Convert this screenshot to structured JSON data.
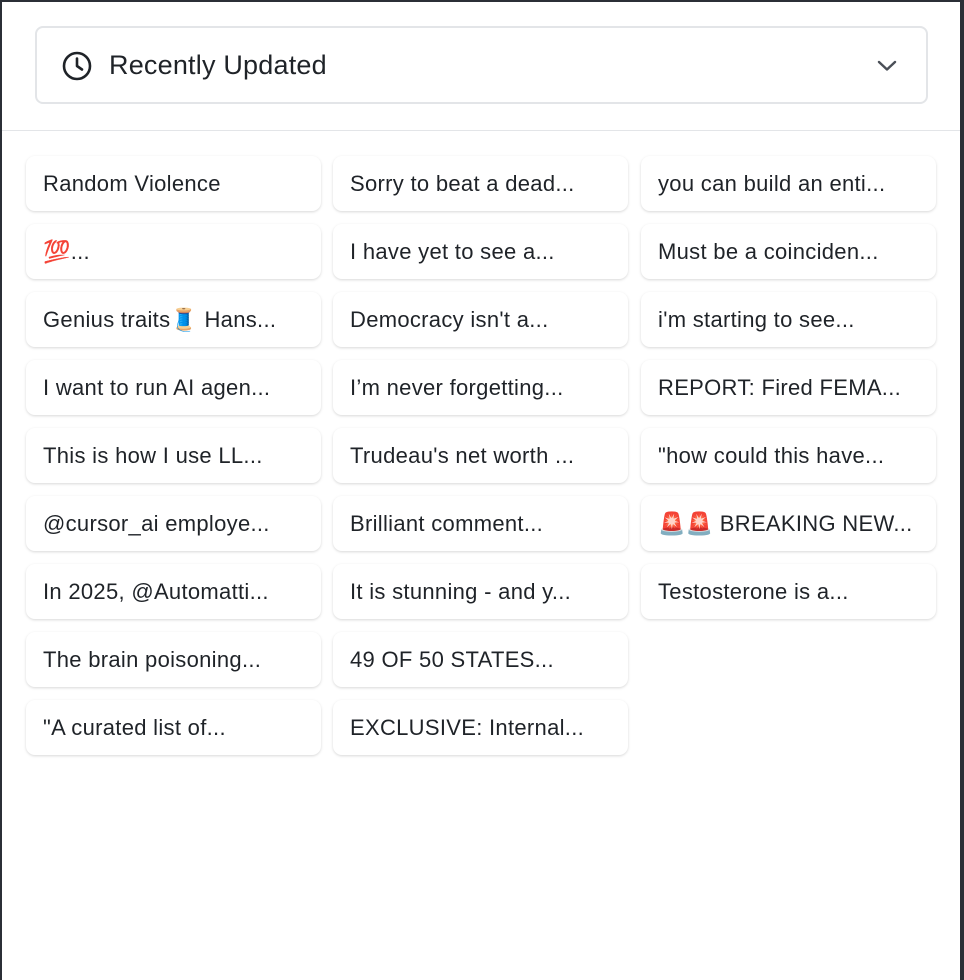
{
  "filter": {
    "label": "Recently Updated",
    "icon": "clock-icon",
    "dropdown_icon": "chevron-down-icon"
  },
  "columns": [
    [
      "Random Violence",
      "💯...",
      "Genius traits🧵 Hans...",
      "I want to run AI agen...",
      "This is how I use LL...",
      "@cursor_ai employe...",
      "In 2025, @Automatti...",
      "The brain poisoning...",
      "\"A curated list of..."
    ],
    [
      "Sorry to beat a dead...",
      "I have yet to see a...",
      "Democracy isn't a...",
      "I’m never forgetting...",
      "Trudeau's net worth ...",
      "Brilliant comment...",
      "It is stunning - and y...",
      "49 OF 50 STATES...",
      "EXCLUSIVE: Internal..."
    ],
    [
      "you can build an enti...",
      "Must be a coinciden...",
      "i'm starting to see...",
      "REPORT: Fired FEMA...",
      "\"how could this have...",
      "🚨🚨 BREAKING NEW...",
      "Testosterone is a..."
    ]
  ],
  "colors": {
    "text": "#1f2328",
    "border": "#e3e5e8",
    "frame": "#2b2f36",
    "background": "#ffffff"
  }
}
